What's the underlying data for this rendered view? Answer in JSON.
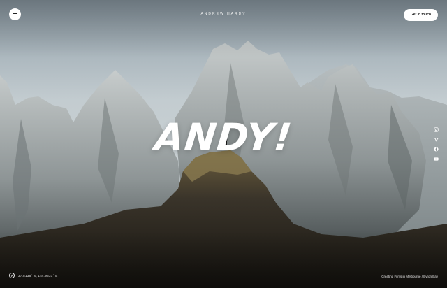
{
  "header": {
    "brand": "ANDREW HARDY",
    "cta_label": "Get in touch",
    "menu_icon": "hamburger-menu-icon"
  },
  "hero": {
    "title": "ANDY!"
  },
  "social": [
    {
      "icon": "instagram-icon"
    },
    {
      "icon": "vimeo-icon"
    },
    {
      "icon": "facebook-icon"
    },
    {
      "icon": "youtube-icon"
    }
  ],
  "footer": {
    "coordinates": "37.8136° S, 144.9631° E",
    "tagline": "Creating Films in Melbourne / Byron Bay"
  },
  "colors": {
    "sky": "#c9d1d4",
    "rock_light": "#b9bfbf",
    "rock_shadow": "#5b6364",
    "ridge_dark": "#2a2620",
    "ridge_sun": "#7a6a45"
  }
}
